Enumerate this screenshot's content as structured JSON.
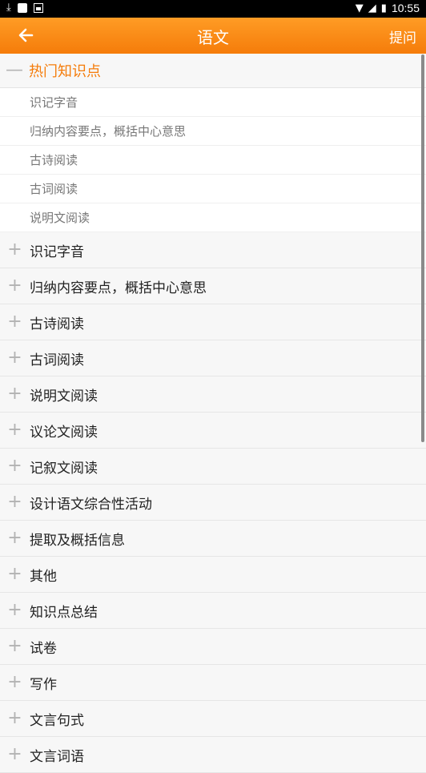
{
  "status": {
    "time": "10:55"
  },
  "appbar": {
    "title": "语文",
    "action": "提问"
  },
  "hot": {
    "label": "热门知识点",
    "items": [
      "识记字音",
      "归纳内容要点，概括中心意思",
      "古诗阅读",
      "古词阅读",
      "说明文阅读"
    ]
  },
  "groups": [
    "识记字音",
    "归纳内容要点，概括中心意思",
    "古诗阅读",
    "古词阅读",
    "说明文阅读",
    "议论文阅读",
    "记叙文阅读",
    "设计语文综合性活动",
    "提取及概括信息",
    "其他",
    "知识点总结",
    "试卷",
    "写作",
    "文言句式",
    "文言词语"
  ],
  "colors": {
    "accent": "#f57c0a"
  }
}
